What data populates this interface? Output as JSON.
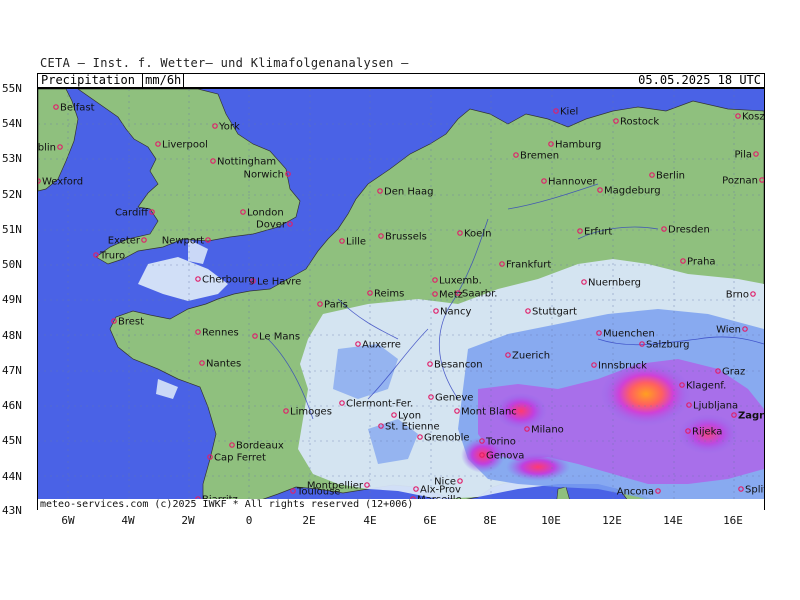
{
  "header": {
    "institute": "CETA — Inst. f. Wetter— und Klimafolgenanalysen —",
    "field": "Precipitation",
    "units": "mm/6h",
    "valid_time": "05.05.2025  18 UTC"
  },
  "footer": "meteo-services.com  (c)2025 IWKF  * All rights reserved (12+006)",
  "axes": {
    "lat_labels": [
      "55N",
      "54N",
      "53N",
      "52N",
      "51N",
      "50N",
      "49N",
      "48N",
      "47N",
      "46N",
      "45N",
      "44N",
      "43N"
    ],
    "lon_labels": [
      "6W",
      "4W",
      "2W",
      "0",
      "2E",
      "4E",
      "6E",
      "8E",
      "10E",
      "12E",
      "14E",
      "16E"
    ]
  },
  "colors": {
    "sea": "#4a62e6",
    "land": "#8fc07e",
    "light_precip": "#d8e6f8",
    "moderate_precip": "#7aa0f0",
    "heavy_precip": "#c050e0",
    "extreme_precip": "#ff6060",
    "core": "#ffa020"
  },
  "cities": [
    "Belfast",
    "Dublin",
    "Wexford",
    "York",
    "Liverpool",
    "Nottingham",
    "Norwich",
    "Cardiff",
    "London",
    "Dover",
    "Exeter",
    "Newport",
    "Truro",
    "Kiel",
    "Rostock",
    "Koszalin",
    "Hamburg",
    "Bremen",
    "Pila",
    "Berlin",
    "Hannover",
    "Magdeburg",
    "Poznan",
    "Den Haag",
    "Koeln",
    "Brussels",
    "Erfurt",
    "Dresden",
    "Lille",
    "Frankfurt",
    "Praha",
    "Le Havre",
    "Cherbourg",
    "Luxemb.",
    "Saarbr.",
    "Metz",
    "Reims",
    "Paris",
    "Nuernberg",
    "Brno",
    "Nancy",
    "Stuttgart",
    "Brest",
    "Rennes",
    "Le Mans",
    "Muenchen",
    "Wien",
    "Salzburg",
    "Zuerich",
    "Auxerre",
    "Nantes",
    "Besancon",
    "Innsbruck",
    "Graz",
    "Klagenf.",
    "Ljubljana",
    "Zagreb",
    "Limoges",
    "Clermont-Fer.",
    "Geneve",
    "Mont Blanc",
    "Lyon",
    "Milano",
    "St. Etienne",
    "Grenoble",
    "Rijeka",
    "Torino",
    "Bordeaux",
    "Genova",
    "Cap Ferret",
    "Montpellier",
    "Nice",
    "Alx-Prov",
    "Toulouse",
    "Marseille",
    "Biarritz",
    "Ancona",
    "Split"
  ]
}
